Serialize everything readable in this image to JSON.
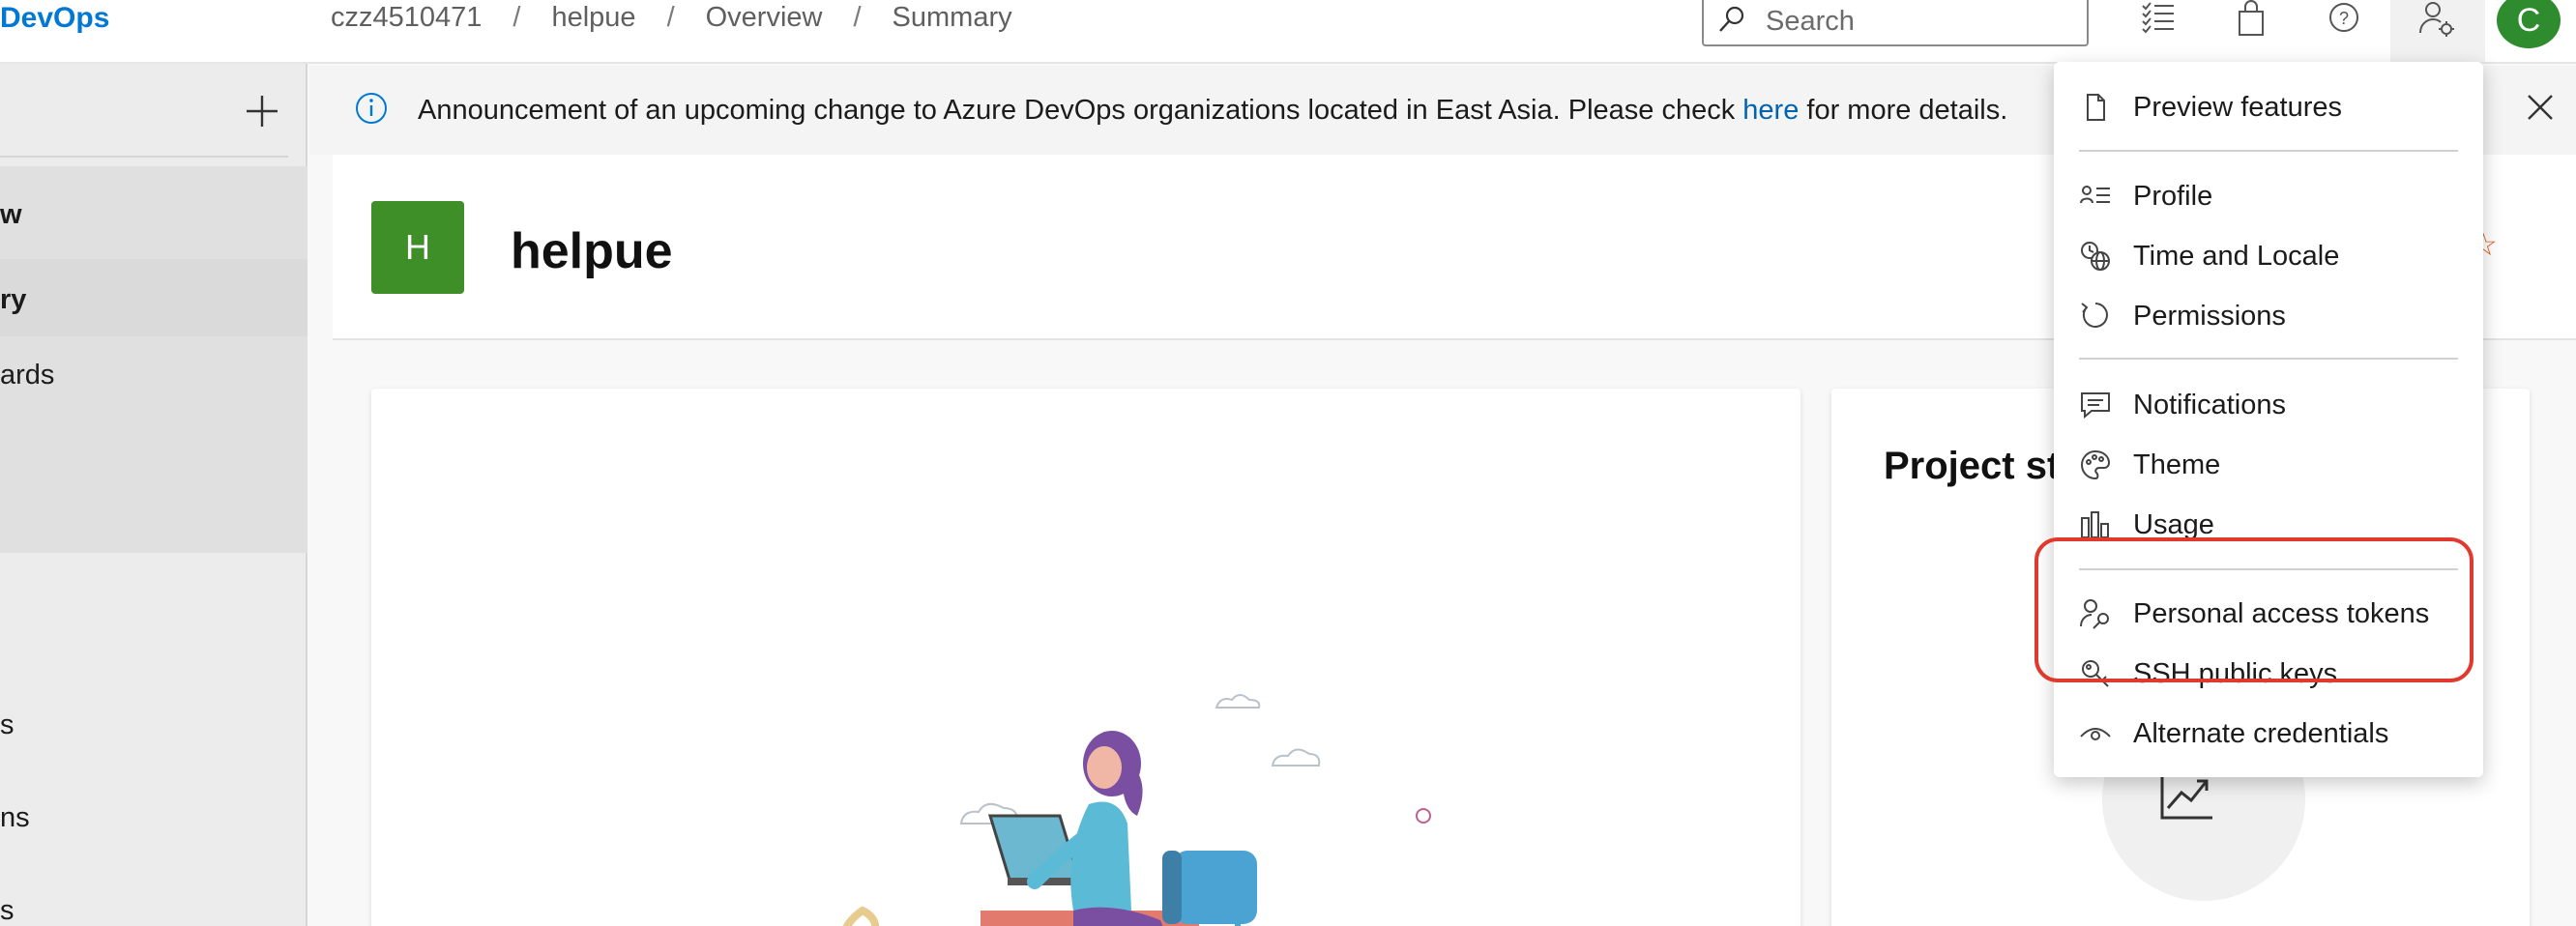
{
  "topbar": {
    "brand": "DevOps",
    "breadcrumbs": [
      "czz4510471",
      "helpue",
      "Overview",
      "Summary"
    ],
    "search_placeholder": "Search",
    "user_initial": "C"
  },
  "leftnav": {
    "items": [
      "w",
      "ry",
      "ards",
      "s",
      "ns",
      "s"
    ]
  },
  "banner": {
    "text_before": "Announcement of an upcoming change to Azure DevOps organizations located in East Asia. Please check ",
    "link": "here",
    "text_after": " for more details."
  },
  "project": {
    "initial": "H",
    "name": "helpue"
  },
  "stats_card": {
    "title": "Project st"
  },
  "menu": {
    "items": [
      {
        "label": "Preview features",
        "icon": "document-icon"
      },
      {
        "label": "Profile",
        "icon": "profile-icon"
      },
      {
        "label": "Time and Locale",
        "icon": "globe-clock-icon"
      },
      {
        "label": "Permissions",
        "icon": "refresh-circle-icon"
      },
      {
        "label": "Notifications",
        "icon": "chat-icon"
      },
      {
        "label": "Theme",
        "icon": "palette-icon"
      },
      {
        "label": "Usage",
        "icon": "bar-chart-icon"
      },
      {
        "label": "Personal access tokens",
        "icon": "person-key-icon"
      },
      {
        "label": "SSH public keys",
        "icon": "key-icon"
      },
      {
        "label": "Alternate credentials",
        "icon": "eye-icon"
      }
    ]
  },
  "colors": {
    "brand_blue": "#0078d4",
    "link_blue": "#0063b1",
    "project_green": "#3f8f28",
    "avatar_green": "#2e8b2e",
    "highlight_red": "#e03a2e"
  }
}
